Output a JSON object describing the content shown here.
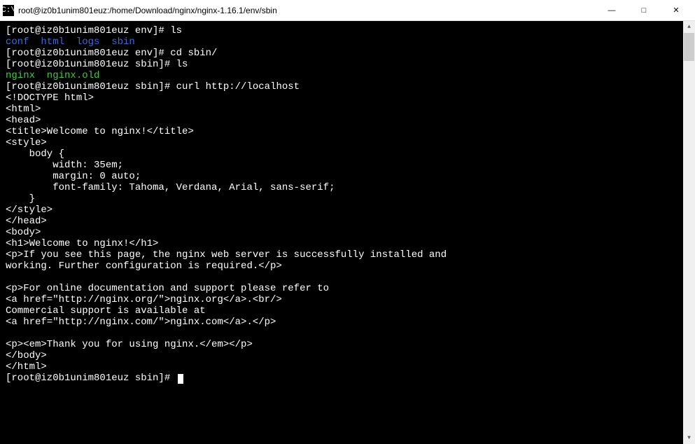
{
  "window": {
    "title": "root@iz0b1unim801euz:/home/Download/nginx/nginx-1.16.1/env/sbin",
    "icon_text": "C:\\",
    "controls": {
      "minimize": "—",
      "maximize": "□",
      "close": "✕"
    }
  },
  "terminal": {
    "lines": [
      {
        "type": "prompt_cmd",
        "prompt": "[root@iz0b1unim801euz env]# ",
        "cmd": "ls"
      },
      {
        "type": "blue",
        "text": "conf  html  logs  sbin"
      },
      {
        "type": "prompt_cmd",
        "prompt": "[root@iz0b1unim801euz env]# ",
        "cmd": "cd sbin/"
      },
      {
        "type": "prompt_cmd",
        "prompt": "[root@iz0b1unim801euz sbin]# ",
        "cmd": "ls"
      },
      {
        "type": "green",
        "text": "nginx  nginx.old"
      },
      {
        "type": "prompt_cmd",
        "prompt": "[root@iz0b1unim801euz sbin]# ",
        "cmd": "curl http://localhost"
      },
      {
        "type": "plain",
        "text": "<!DOCTYPE html>"
      },
      {
        "type": "plain",
        "text": "<html>"
      },
      {
        "type": "plain",
        "text": "<head>"
      },
      {
        "type": "plain",
        "text": "<title>Welcome to nginx!</title>"
      },
      {
        "type": "plain",
        "text": "<style>"
      },
      {
        "type": "plain",
        "text": "    body {"
      },
      {
        "type": "plain",
        "text": "        width: 35em;"
      },
      {
        "type": "plain",
        "text": "        margin: 0 auto;"
      },
      {
        "type": "plain",
        "text": "        font-family: Tahoma, Verdana, Arial, sans-serif;"
      },
      {
        "type": "plain",
        "text": "    }"
      },
      {
        "type": "plain",
        "text": "</style>"
      },
      {
        "type": "plain",
        "text": "</head>"
      },
      {
        "type": "plain",
        "text": "<body>"
      },
      {
        "type": "plain",
        "text": "<h1>Welcome to nginx!</h1>"
      },
      {
        "type": "plain",
        "text": "<p>If you see this page, the nginx web server is successfully installed and"
      },
      {
        "type": "plain",
        "text": "working. Further configuration is required.</p>"
      },
      {
        "type": "plain",
        "text": ""
      },
      {
        "type": "plain",
        "text": "<p>For online documentation and support please refer to"
      },
      {
        "type": "plain",
        "text": "<a href=\"http://nginx.org/\">nginx.org</a>.<br/>"
      },
      {
        "type": "plain",
        "text": "Commercial support is available at"
      },
      {
        "type": "plain",
        "text": "<a href=\"http://nginx.com/\">nginx.com</a>.</p>"
      },
      {
        "type": "plain",
        "text": ""
      },
      {
        "type": "plain",
        "text": "<p><em>Thank you for using nginx.</em></p>"
      },
      {
        "type": "plain",
        "text": "</body>"
      },
      {
        "type": "plain",
        "text": "</html>"
      },
      {
        "type": "prompt_cursor",
        "prompt": "[root@iz0b1unim801euz sbin]# "
      }
    ]
  }
}
